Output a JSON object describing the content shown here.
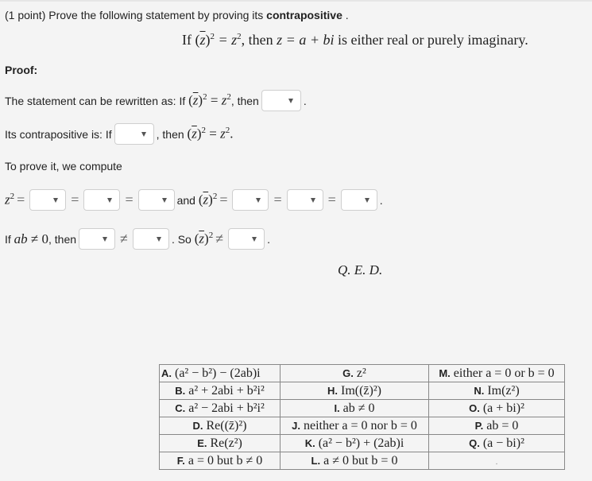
{
  "header": {
    "points": "(1 point)",
    "instruction": "Prove the following statement by proving its",
    "emphasis": "contrapositive",
    "end": "."
  },
  "statement": {
    "if": "If",
    "zbar": "z",
    "eq": "= z",
    "then": ", then",
    "zdef": "z = a + bi",
    "rest": "is either real or purely imaginary."
  },
  "proof": {
    "title": "Proof:",
    "line1_prefix": "The statement can be rewritten as: If",
    "line1_mid": ", then",
    "line2_prefix": "Its contrapositive is: If",
    "line2_mid": ", then",
    "line3": "To prove it, we compute",
    "line4_and": "and",
    "line5_prefix": "If",
    "line5_then": ", then",
    "line5_so": ". So",
    "qed": "Q. E. D."
  },
  "dropdowns": {
    "rewritten_then": "",
    "contra_if": "",
    "z2_step1": "",
    "z2_step2": "",
    "z2_step3": "",
    "zbar2_step1": "",
    "zbar2_step2": "",
    "zbar2_step3": "",
    "ne_left": "",
    "ne_right": "",
    "so_ne": ""
  },
  "options": [
    [
      {
        "label": "A.",
        "expr": "(a² − b²) − (2ab)i"
      },
      {
        "label": "G.",
        "expr": "z²"
      },
      {
        "label": "M.",
        "expr": "either a = 0 or b = 0"
      }
    ],
    [
      {
        "label": "B.",
        "expr": "a² + 2abi + b²i²"
      },
      {
        "label": "H.",
        "expr": "Im((z̄)²)"
      },
      {
        "label": "N.",
        "expr": "Im(z²)"
      }
    ],
    [
      {
        "label": "C.",
        "expr": "a² − 2abi + b²i²"
      },
      {
        "label": "I.",
        "expr": "ab ≠ 0"
      },
      {
        "label": "O.",
        "expr": "(a + bi)²"
      }
    ],
    [
      {
        "label": "D.",
        "expr": "Re((z̄)²)"
      },
      {
        "label": "J.",
        "expr": "neither a = 0 nor b = 0"
      },
      {
        "label": "P.",
        "expr": "ab = 0"
      }
    ],
    [
      {
        "label": "E.",
        "expr": "Re(z²)"
      },
      {
        "label": "K.",
        "expr": "(a² − b²) + (2ab)i"
      },
      {
        "label": "Q.",
        "expr": "(a − bi)²"
      }
    ],
    [
      {
        "label": "F.",
        "expr": "a = 0 but b ≠ 0"
      },
      {
        "label": "L.",
        "expr": "a ≠ 0 but b = 0"
      },
      {
        "label": "",
        "expr": "."
      }
    ]
  ]
}
